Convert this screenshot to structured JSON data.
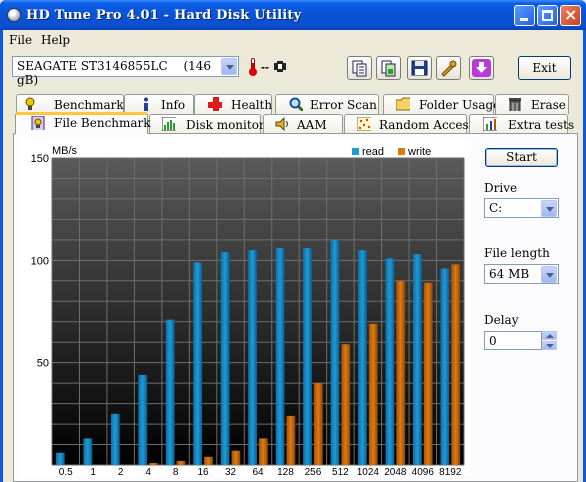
{
  "window": {
    "title": "HD Tune Pro 4.01 - Hard Disk Utility"
  },
  "menu": [
    {
      "label": "File"
    },
    {
      "label": "Help"
    }
  ],
  "toolbar": {
    "drive": "SEAGATE ST3146855LC",
    "drive_size": "(146 gB)",
    "temperature": "--",
    "exit_label": "Exit"
  },
  "tabs_row1": [
    {
      "label": "Benchmark",
      "icon": "benchmark-icon"
    },
    {
      "label": "Info",
      "icon": "info-icon"
    },
    {
      "label": "Health",
      "icon": "health-cross-icon"
    },
    {
      "label": "Error Scan",
      "icon": "magnifier-icon"
    },
    {
      "label": "Folder Usage",
      "icon": "folder-icon"
    },
    {
      "label": "Erase",
      "icon": "trash-icon"
    }
  ],
  "tabs_row2": [
    {
      "label": "File Benchmark",
      "icon": "file-benchmark-icon",
      "active": true
    },
    {
      "label": "Disk monitor",
      "icon": "disk-monitor-icon"
    },
    {
      "label": "AAM",
      "icon": "speaker-icon"
    },
    {
      "label": "Random Access",
      "icon": "random-access-icon"
    },
    {
      "label": "Extra tests",
      "icon": "extra-tests-icon"
    }
  ],
  "side": {
    "start_label": "Start",
    "drive_label": "Drive",
    "drive_value": "C:",
    "file_length_label": "File length",
    "file_length_value": "64 MB",
    "delay_label": "Delay",
    "delay_value": "0"
  },
  "colors": {
    "read": "#1e9bd7",
    "write": "#e07a10",
    "chart_bg_top": "#5a5a5a",
    "chart_bg_bottom": "#000000"
  },
  "chart_data": {
    "type": "bar",
    "ylabel": "MB/s",
    "ylim": [
      0,
      150
    ],
    "yticks": [
      "150",
      "100",
      "50"
    ],
    "categories": [
      "0.5",
      "1",
      "2",
      "4",
      "8",
      "16",
      "32",
      "64",
      "128",
      "256",
      "512",
      "1024",
      "2048",
      "4096",
      "8192"
    ],
    "legend_position": "top-right",
    "series": [
      {
        "name": "read",
        "values": [
          6,
          13,
          25,
          44,
          71,
          99,
          104,
          105,
          106,
          106,
          110,
          105,
          101,
          103,
          96
        ]
      },
      {
        "name": "write",
        "values": [
          0,
          0,
          0,
          1,
          2,
          4,
          7,
          13,
          24,
          40,
          59,
          69,
          90,
          89,
          98
        ]
      }
    ]
  }
}
